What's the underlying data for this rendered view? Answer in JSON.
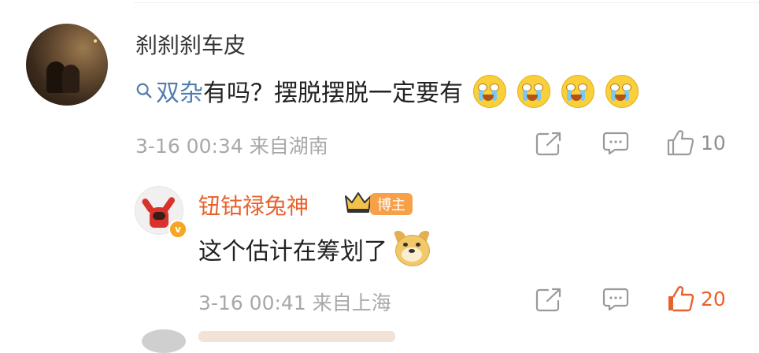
{
  "comment": {
    "username": "刹刹刹车皮",
    "topic": "双杂",
    "text": "有吗？摆脱摆脱一定要有",
    "emoji_count": 4,
    "emoji_name": "tearful-face-emoji",
    "date": "3-16 00:34",
    "location": "来自湖南",
    "likes": "10",
    "liked": false
  },
  "reply": {
    "username": "钮钴禄兔神",
    "badge": "博主",
    "verified_icon": "v",
    "text": "这个估计在筹划了",
    "emoji_name": "doge-emoji",
    "date": "3-16 00:41",
    "location": "来自上海",
    "likes": "20",
    "liked": true
  },
  "colors": {
    "name": "#333333",
    "text": "#222222",
    "meta": "#a8a8a8",
    "topic": "#507daf",
    "accent": "#e8612c",
    "badge": "#f7a04a"
  }
}
